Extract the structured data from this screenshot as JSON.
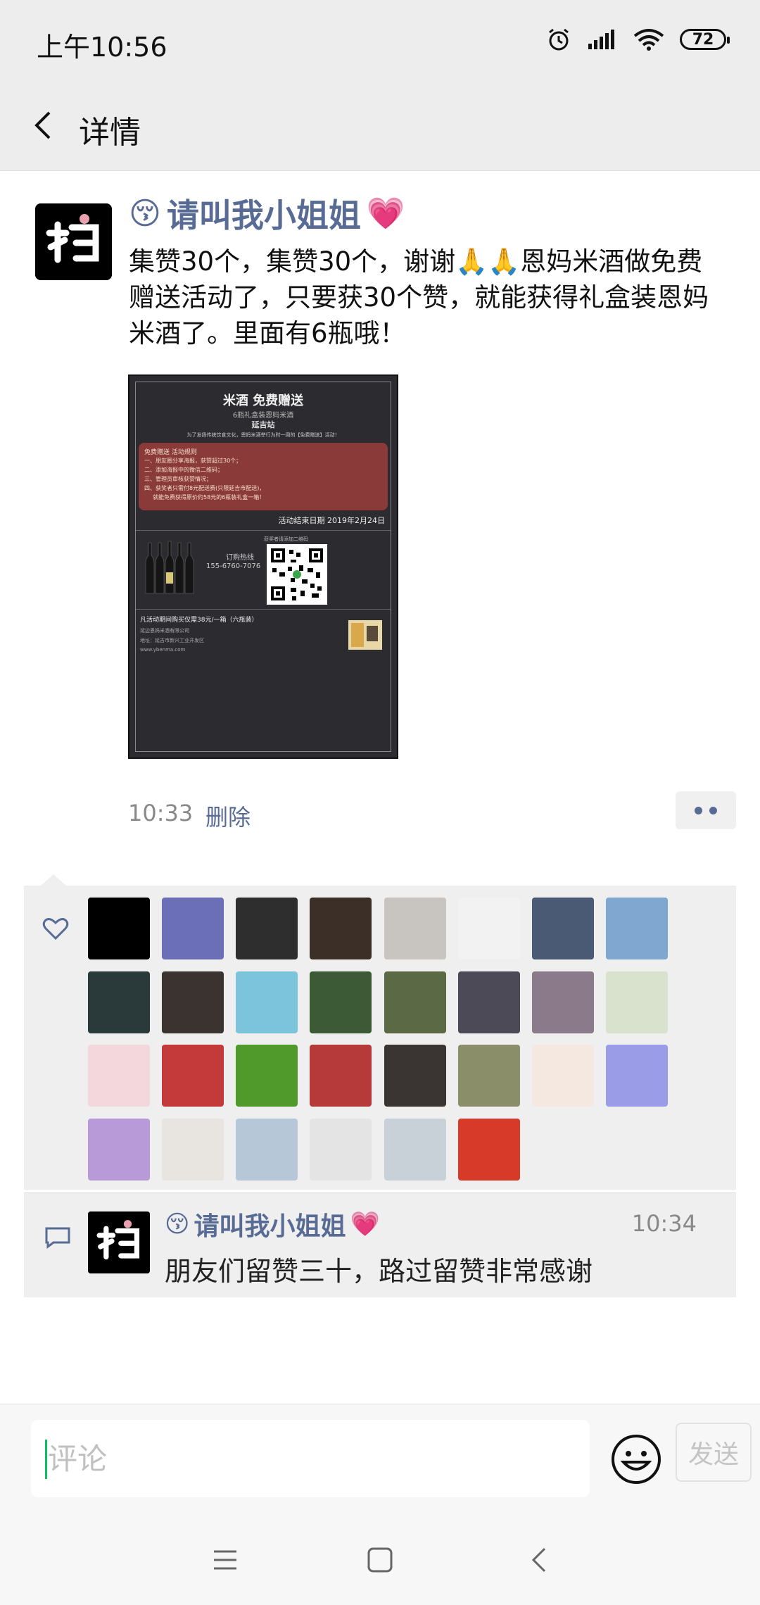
{
  "status_bar": {
    "time": "上午10:56",
    "battery": "72"
  },
  "header": {
    "title": "详情"
  },
  "post": {
    "author": "请叫我小姐姐",
    "text": "集赞30个，集赞30个，谢谢🙏🙏恩妈米酒做免费赠送活动了，只要获30个赞，就能获得礼盒装恩妈米酒了。里面有6瓶哦！",
    "time": "10:33",
    "delete_label": "删除",
    "image": {
      "title": "米酒 免费赠送",
      "subtitle": "6瓶礼盒装恩妈米酒",
      "location": "延吉站",
      "intro": "为了发扬传统饮食文化，恩妈米酒举行为时一周的【免费赠送】活动！",
      "rules_title": "免费赠送 活动规则",
      "rules": [
        "一、朋友圈分享海报，获赞超过30个；",
        "二、添加海报中的微信二维码；",
        "三、管理员审核获赞情况；",
        "四、获奖者只需付8元配送费(只限延吉市配送)，",
        "就能免费获得原价约58元的6瓶装礼盒一箱！"
      ],
      "end_date": "活动结束日期 2019年2月24日",
      "hotline_label": "订购热线",
      "hotline": "155-6760-7076",
      "qr_label": "获奖者请添加二维码",
      "promo": "凡活动期间购买仅需38元/一箱（六瓶装）",
      "company": "延边恩妈米酒有限公司",
      "address": "地址：延吉市新兴工业开发区",
      "website": "www.ybenma.com"
    }
  },
  "likes": {
    "avatars": [
      {
        "name": "liker-1",
        "color": "#000000"
      },
      {
        "name": "liker-2",
        "color": "#6a6fb8"
      },
      {
        "name": "liker-3",
        "color": "#2e2e2e"
      },
      {
        "name": "liker-4",
        "color": "#3c2f28"
      },
      {
        "name": "liker-5",
        "color": "#c8c4c0"
      },
      {
        "name": "liker-6",
        "color": "#f2f2f2"
      },
      {
        "name": "liker-7",
        "color": "#4a5a74"
      },
      {
        "name": "liker-8",
        "color": "#7fa7d0"
      },
      {
        "name": "liker-9",
        "color": "#2a3a3a"
      },
      {
        "name": "liker-10",
        "color": "#3a3330"
      },
      {
        "name": "liker-11",
        "color": "#7cc4dc"
      },
      {
        "name": "liker-12",
        "color": "#3d5a36"
      },
      {
        "name": "liker-13",
        "color": "#5b6a44"
      },
      {
        "name": "liker-14",
        "color": "#4d4a58"
      },
      {
        "name": "liker-15",
        "color": "#8a7a8a"
      },
      {
        "name": "liker-16",
        "color": "#d9e2cc"
      },
      {
        "name": "liker-17",
        "color": "#f3d7dc"
      },
      {
        "name": "liker-18",
        "color": "#c43a3a"
      },
      {
        "name": "liker-19",
        "color": "#4f9a2a"
      },
      {
        "name": "liker-20",
        "color": "#b63a3a"
      },
      {
        "name": "liker-21",
        "color": "#3a3532"
      },
      {
        "name": "liker-22",
        "color": "#8a8f6a"
      },
      {
        "name": "liker-23",
        "color": "#f5e8e0"
      },
      {
        "name": "liker-24",
        "color": "#9a9ce8"
      },
      {
        "name": "liker-25",
        "color": "#b89ad8"
      },
      {
        "name": "liker-26",
        "color": "#e8e4e0"
      },
      {
        "name": "liker-27",
        "color": "#b6c8d8"
      },
      {
        "name": "liker-28",
        "color": "#e4e4e4"
      },
      {
        "name": "liker-29",
        "color": "#c8d0d8"
      },
      {
        "name": "liker-30",
        "color": "#d83a2a"
      }
    ]
  },
  "comments": [
    {
      "author": "请叫我小姐姐",
      "time": "10:34",
      "text": "朋友们留赞三十，路过留赞非常感谢"
    }
  ],
  "input": {
    "placeholder": "评论",
    "send_label": "发送"
  },
  "icons": {
    "back": "back-arrow-icon",
    "like": "heart-icon",
    "comment": "comment-icon",
    "emoji": "emoji-icon",
    "alarm": "alarm-icon",
    "signal": "signal-icon",
    "wifi": "wifi-icon"
  },
  "colors": {
    "link": "#576b95",
    "accent": "#07c160",
    "background": "#ededed"
  }
}
